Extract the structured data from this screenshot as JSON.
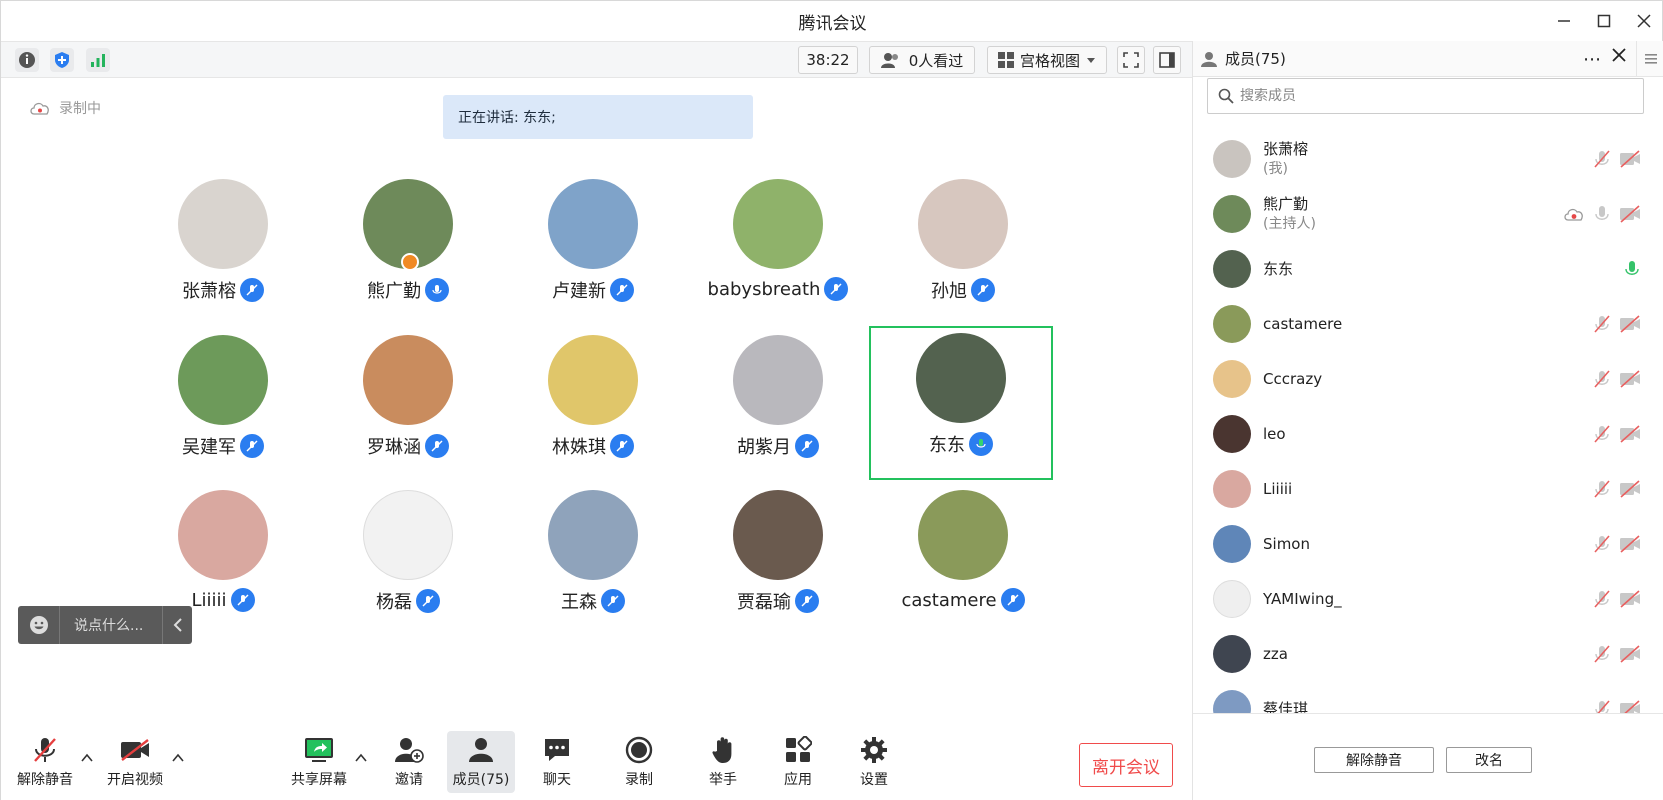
{
  "window": {
    "title": "腾讯会议"
  },
  "topbar": {
    "timer": "38:22",
    "viewers": "0人看过",
    "view_mode": "宫格视图"
  },
  "stage": {
    "recording_label": "录制中",
    "speaking_label": "正在讲话: 东东;",
    "participants": [
      {
        "name": "张萧榕",
        "avatar_color": "#d9d4cf"
      },
      {
        "name": "熊广勤",
        "avatar_color": "#6e8a5a",
        "host_badge": true
      },
      {
        "name": "卢建新",
        "avatar_color": "#7fa3c9"
      },
      {
        "name": "babysbreath",
        "avatar_color": "#8fb26a"
      },
      {
        "name": "孙旭",
        "avatar_color": "#d7c7bf"
      },
      {
        "name": "吴建军",
        "avatar_color": "#6d9a5a"
      },
      {
        "name": "罗琳涵",
        "avatar_color": "#c98c5e"
      },
      {
        "name": "林姝琪",
        "avatar_color": "#e0c66a"
      },
      {
        "name": "胡紫月",
        "avatar_color": "#b9b8bd"
      },
      {
        "name": "东东",
        "avatar_color": "#53624f",
        "active": true
      },
      {
        "name": "Liiiii",
        "avatar_color": "#d9a8a0"
      },
      {
        "name": "杨磊",
        "avatar_color": "#f2f2f2"
      },
      {
        "name": "王森",
        "avatar_color": "#8fa3bb"
      },
      {
        "name": "贾磊瑜",
        "avatar_color": "#6a5a4e"
      },
      {
        "name": "castamere",
        "avatar_color": "#8a9a5a"
      }
    ],
    "chat_placeholder": "说点什么..."
  },
  "bottombar": {
    "unmute": "解除静音",
    "start_video": "开启视频",
    "share_screen": "共享屏幕",
    "invite": "邀请",
    "members": "成员(75)",
    "chat": "聊天",
    "record": "录制",
    "raise_hand": "举手",
    "apps": "应用",
    "settings": "设置",
    "leave": "离开会议"
  },
  "panel": {
    "title": "成员(75)",
    "search_placeholder": "搜索成员",
    "members": [
      {
        "name": "张萧榕",
        "role": "(我)",
        "avatar_color": "#c9c4bf",
        "mic": "muted",
        "video": "off"
      },
      {
        "name": "熊广勤",
        "role": "(主持人)",
        "avatar_color": "#6e8a5a",
        "mic": "idle",
        "video": "off",
        "recording": true
      },
      {
        "name": "东东",
        "role": "",
        "avatar_color": "#53624f",
        "mic": "active",
        "video": "none"
      },
      {
        "name": "castamere",
        "role": "",
        "avatar_color": "#8a9a5a",
        "mic": "muted",
        "video": "off"
      },
      {
        "name": "Cccrazy",
        "role": "",
        "avatar_color": "#e7c38a",
        "mic": "muted",
        "video": "off"
      },
      {
        "name": "leo",
        "role": "",
        "avatar_color": "#4a3530",
        "mic": "muted",
        "video": "off"
      },
      {
        "name": "Liiiii",
        "role": "",
        "avatar_color": "#d9a8a0",
        "mic": "muted",
        "video": "off"
      },
      {
        "name": "Simon",
        "role": "",
        "avatar_color": "#5f86b8",
        "mic": "muted",
        "video": "off"
      },
      {
        "name": "YAMIwing_",
        "role": "",
        "avatar_color": "#efefef",
        "mic": "muted",
        "video": "off"
      },
      {
        "name": "zza",
        "role": "",
        "avatar_color": "#3f4550",
        "mic": "muted",
        "video": "off"
      },
      {
        "name": "蔡佳琪",
        "role": "",
        "avatar_color": "#7e9ac2",
        "mic": "muted",
        "video": "off"
      }
    ],
    "unmute_all": "解除静音",
    "rename": "改名"
  },
  "colors": {
    "accent": "#2a7df0",
    "active_border": "#23c15d",
    "leave": "#f04b4b"
  }
}
